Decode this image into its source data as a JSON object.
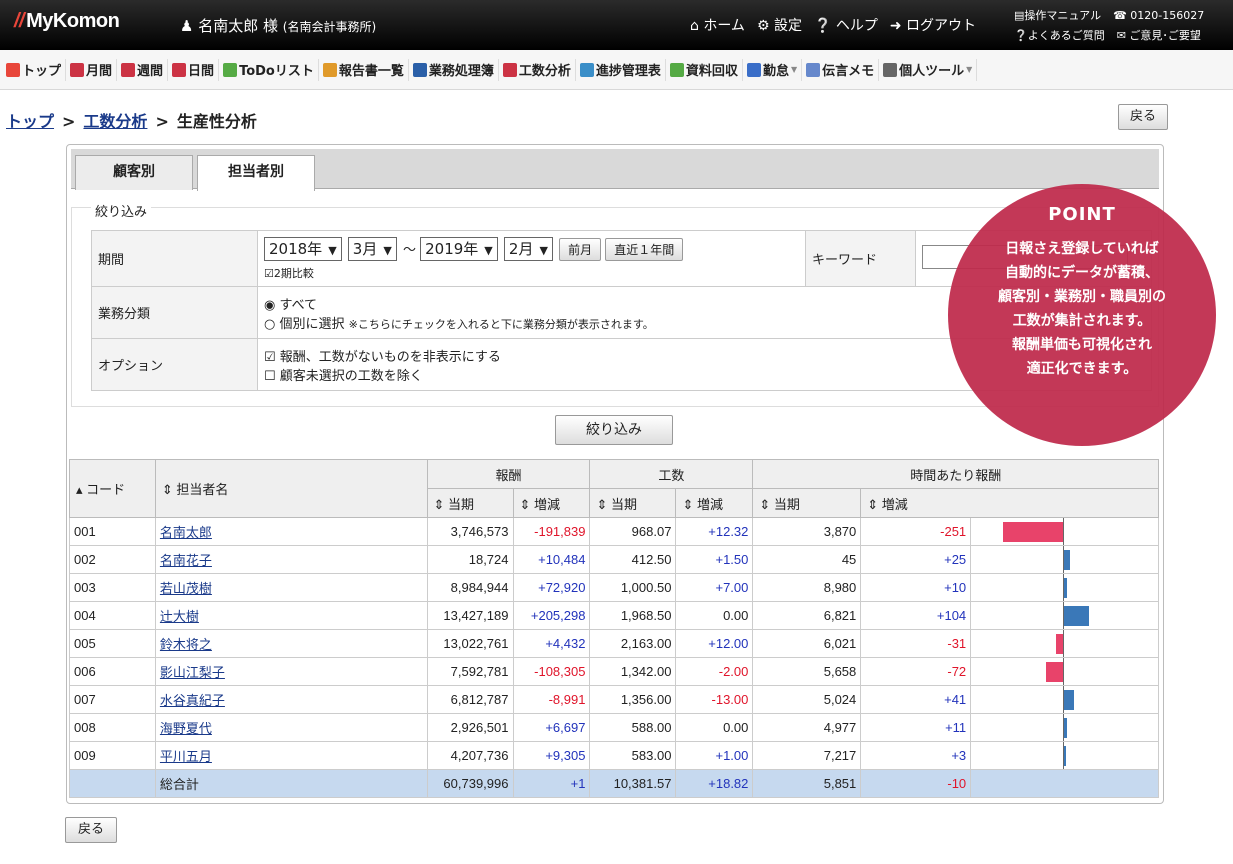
{
  "app": {
    "logo": "MyKomon",
    "user": "名南太郎 様",
    "office": "(名南会計事務所)"
  },
  "topnav": {
    "home": "ホーム",
    "settings": "設定",
    "help": "ヘルプ",
    "logout": "ログアウト"
  },
  "topright": {
    "manual": "操作マニュアル",
    "phone": "0120-156027",
    "faq": "よくあるご質問",
    "feedback": "ご意見･ご要望"
  },
  "toolbar": [
    {
      "label": "トップ",
      "color": "#e8463a"
    },
    {
      "label": "月間",
      "color": "#cc3344"
    },
    {
      "label": "週間",
      "color": "#cc3344"
    },
    {
      "label": "日間",
      "color": "#cc3344"
    },
    {
      "label": "ToDoリスト",
      "color": "#55aa44"
    },
    {
      "label": "報告書一覧",
      "color": "#e09a2a"
    },
    {
      "label": "業務処理簿",
      "color": "#2a5fa8"
    },
    {
      "label": "工数分析",
      "color": "#cc3344"
    },
    {
      "label": "進捗管理表",
      "color": "#3a8ec8"
    },
    {
      "label": "資料回収",
      "color": "#55aa44"
    },
    {
      "label": "勤怠",
      "color": "#3a6ec8"
    },
    {
      "label": "伝言メモ",
      "color": "#6688cc"
    },
    {
      "label": "個人ツール",
      "color": "#666666"
    }
  ],
  "breadcrumb": {
    "top": "トップ",
    "mid": "工数分析",
    "current": "生産性分析",
    "sep": ">"
  },
  "back_label": "戻る",
  "tabs": {
    "customer": "顧客別",
    "staff": "担当者別"
  },
  "filter": {
    "title": "絞り込み",
    "period_label": "期間",
    "from_year": "2018年",
    "from_month": "3月",
    "tilde": "～",
    "to_year": "2019年",
    "to_month": "2月",
    "prev_btn": "前月",
    "recent_btn": "直近１年間",
    "compare": "2期比較",
    "keyword_label": "キーワード",
    "category_label": "業務分類",
    "all": "すべて",
    "individual": "個別に選択",
    "individual_note": "※こちらにチェックを入れると下に業務分類が表示されます。",
    "option_label": "オプション",
    "opt1": "報酬、工数がないものを非表示にする",
    "opt2": "顧客未選択の工数を除く",
    "submit": "絞り込み"
  },
  "table": {
    "h_code": "コード",
    "h_name": "担当者名",
    "h_fee": "報酬",
    "h_hours": "工数",
    "h_rate": "時間あたり報酬",
    "h_cur": "当期",
    "h_diff": "増減",
    "rows": [
      {
        "code": "001",
        "name": "名南太郎",
        "fee": "3,746,573",
        "fee_d": "-191,839",
        "hrs": "968.07",
        "hrs_d": "+12.32",
        "rate": "3,870",
        "rate_d": "-251",
        "bar": -251
      },
      {
        "code": "002",
        "name": "名南花子",
        "fee": "18,724",
        "fee_d": "+10,484",
        "hrs": "412.50",
        "hrs_d": "+1.50",
        "rate": "45",
        "rate_d": "+25",
        "bar": 25
      },
      {
        "code": "003",
        "name": "若山茂樹",
        "fee": "8,984,944",
        "fee_d": "+72,920",
        "hrs": "1,000.50",
        "hrs_d": "+7.00",
        "rate": "8,980",
        "rate_d": "+10",
        "bar": 10
      },
      {
        "code": "004",
        "name": "辻大樹",
        "fee": "13,427,189",
        "fee_d": "+205,298",
        "hrs": "1,968.50",
        "hrs_d": "0.00",
        "rate": "6,821",
        "rate_d": "+104",
        "bar": 104
      },
      {
        "code": "005",
        "name": "鈴木将之",
        "fee": "13,022,761",
        "fee_d": "+4,432",
        "hrs": "2,163.00",
        "hrs_d": "+12.00",
        "rate": "6,021",
        "rate_d": "-31",
        "bar": -31
      },
      {
        "code": "006",
        "name": "影山江梨子",
        "fee": "7,592,781",
        "fee_d": "-108,305",
        "hrs": "1,342.00",
        "hrs_d": "-2.00",
        "rate": "5,658",
        "rate_d": "-72",
        "bar": -72
      },
      {
        "code": "007",
        "name": "水谷真紀子",
        "fee": "6,812,787",
        "fee_d": "-8,991",
        "hrs": "1,356.00",
        "hrs_d": "-13.00",
        "rate": "5,024",
        "rate_d": "+41",
        "bar": 41
      },
      {
        "code": "008",
        "name": "海野夏代",
        "fee": "2,926,501",
        "fee_d": "+6,697",
        "hrs": "588.00",
        "hrs_d": "0.00",
        "rate": "4,977",
        "rate_d": "+11",
        "bar": 11
      },
      {
        "code": "009",
        "name": "平川五月",
        "fee": "4,207,736",
        "fee_d": "+9,305",
        "hrs": "583.00",
        "hrs_d": "+1.00",
        "rate": "7,217",
        "rate_d": "+3",
        "bar": 3
      }
    ],
    "total": {
      "label": "総合計",
      "fee": "60,739,996",
      "fee_d": "+1",
      "hrs": "10,381.57",
      "hrs_d": "+18.82",
      "rate": "5,851",
      "rate_d": "-10"
    }
  },
  "colors": {
    "neg_bar": "#e8436a",
    "pos_bar": "#3a78b8"
  },
  "point": {
    "heading": "POINT",
    "text": "日報さえ登録していれば\n自動的にデータが蓄積、\n顧客別・業務別・職員別の\n工数が集計されます。\n報酬単価も可視化され\n適正化できます。"
  }
}
